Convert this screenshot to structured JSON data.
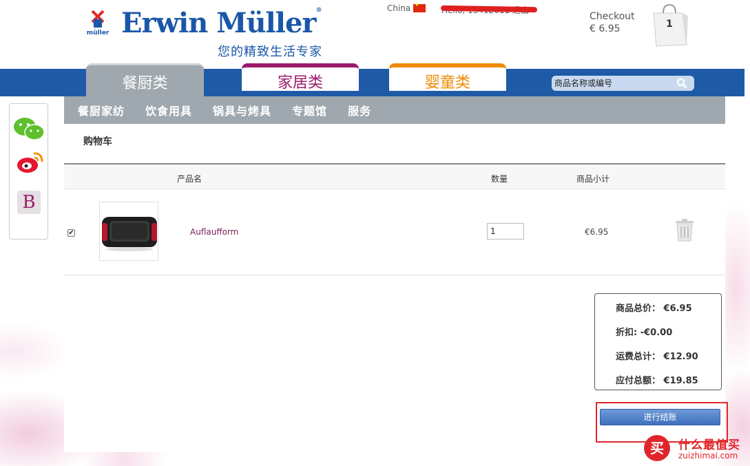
{
  "header": {
    "logo_name": "Erwin Müller",
    "logo_mark_text": "müller",
    "tagline": "您的精致生活专家",
    "country": "China",
    "user_greeting": "Hello, 13412611 退出",
    "checkout_label": "Checkout",
    "checkout_total": "€ 6.95",
    "cart_count": "1"
  },
  "categories": [
    {
      "label": "餐厨类"
    },
    {
      "label": "家居类"
    },
    {
      "label": "婴童类"
    }
  ],
  "search": {
    "placeholder": "商品名称或编号"
  },
  "sub_nav": [
    {
      "label": "餐厨家纺"
    },
    {
      "label": "饮食用具"
    },
    {
      "label": "锅具与烤具"
    },
    {
      "label": "专题馆"
    },
    {
      "label": "服务"
    }
  ],
  "cart": {
    "title": "购物车",
    "columns": {
      "name": "产品名",
      "qty": "数量",
      "subtotal": "商品小计"
    },
    "items": [
      {
        "name": "Auflaufform",
        "qty": "1",
        "subtotal": "€6.95",
        "checked": true
      }
    ],
    "summary": {
      "goods_total": "商品总价： €6.95",
      "discount": "折扣: -€0.00",
      "shipping": "运费总计： €12.90",
      "payable": "应付总额： €19.85"
    },
    "checkout_button": "进行结账"
  },
  "watermark": {
    "badge": "买",
    "cn": "什么最值买",
    "url": "zuizhimai.com"
  },
  "colors": {
    "brand_blue": "#1f5aa6",
    "kitchen_gray": "#9fa8ae",
    "home_purple": "#9b1a6b",
    "baby_orange": "#f08a00",
    "highlight_red": "#e0262b"
  }
}
